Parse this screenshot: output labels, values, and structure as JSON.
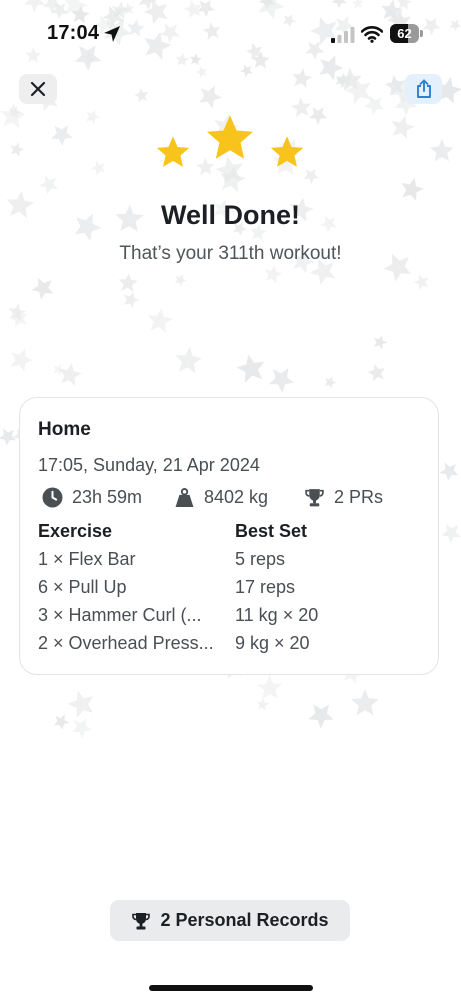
{
  "status_bar": {
    "time": "17:04",
    "battery_level": "62",
    "battery_fraction": 0.62,
    "icons": [
      "location-arrow-icon",
      "cellular-signal-icon",
      "wifi-icon",
      "battery-icon"
    ]
  },
  "header": {
    "close_icon": "close-icon",
    "share_icon": "share-icon"
  },
  "celebration": {
    "star_count": 3,
    "title": "Well Done!",
    "subtitle": "That’s your 311th workout!"
  },
  "workout": {
    "title": "Home",
    "datetime": "17:05, Sunday, 21 Apr 2024",
    "duration": "23h 59m",
    "volume": "8402 kg",
    "prs": "2 PRs",
    "columns": {
      "exercise": "Exercise",
      "best_set": "Best Set"
    },
    "exercises": [
      {
        "name": "1 × Flex Bar",
        "best_set": "5 reps"
      },
      {
        "name": "6 × Pull Up",
        "best_set": "17 reps"
      },
      {
        "name": "3 × Hammer Curl (...",
        "best_set": "11 kg × 20"
      },
      {
        "name": "2 × Overhead Press...",
        "best_set": "9 kg × 20"
      }
    ]
  },
  "records_button": {
    "label": "2 Personal Records",
    "icon": "trophy-icon"
  },
  "colors": {
    "star_gold": "#F8C41C",
    "share_accent": "#2F7FD0",
    "confetti": "#E6E7E8"
  }
}
